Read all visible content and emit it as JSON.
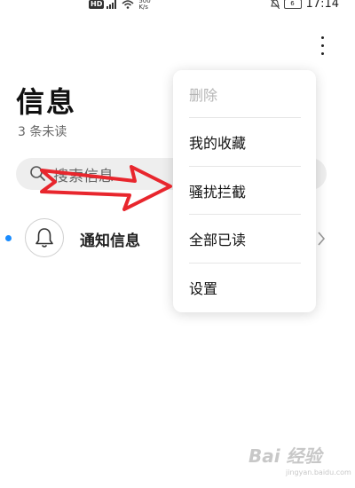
{
  "status_bar": {
    "network_badge": "HD",
    "speed_value": "500",
    "speed_unit": "K/s",
    "battery": "6",
    "time": "17:14"
  },
  "header": {
    "title": "信息",
    "unread_count": "3 条未读"
  },
  "search": {
    "placeholder": "搜索信息"
  },
  "notifications": {
    "label": "通知信息"
  },
  "menu": {
    "items": [
      {
        "label": "删除",
        "enabled": false
      },
      {
        "label": "我的收藏",
        "enabled": true
      },
      {
        "label": "骚扰拦截",
        "enabled": true
      },
      {
        "label": "全部已读",
        "enabled": true
      },
      {
        "label": "设置",
        "enabled": true
      }
    ]
  },
  "watermark": {
    "logo_text": "Bai 经验",
    "site": "jingyan.baidu.com"
  },
  "colors": {
    "accent_dot": "#1a8cff",
    "annotation_arrow": "#e8262d"
  }
}
